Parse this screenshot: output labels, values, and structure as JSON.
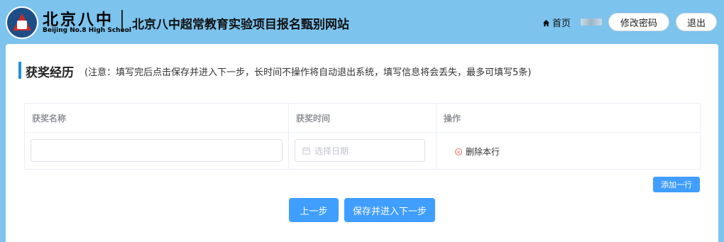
{
  "header": {
    "logo_text_cn": "北京八中",
    "logo_text_en": "Beijing No.8 High School",
    "site_title": "北京八中超常教育实验项目报名甄别网站",
    "home_label": "首页",
    "change_password_label": "修改密码",
    "logout_label": "退出"
  },
  "section": {
    "title": "获奖经历",
    "note": "(注意：填写完后点击保存并进入下一步，长时间不操作将自动退出系统，填写信息将会丢失，最多可填写5条)"
  },
  "table": {
    "columns": [
      "获奖名称",
      "获奖时间",
      "操作"
    ],
    "rows": [
      {
        "name_value": "",
        "date_placeholder": "选择日期",
        "action_label": "删除本行"
      }
    ]
  },
  "buttons": {
    "add_row": "添加一行",
    "prev": "上一步",
    "save_next": "保存并进入下一步"
  },
  "colors": {
    "header_bg": "#7cc3ee",
    "primary": "#409eff",
    "accent_bar": "#1f8fe6",
    "danger": "#f56c6c"
  }
}
